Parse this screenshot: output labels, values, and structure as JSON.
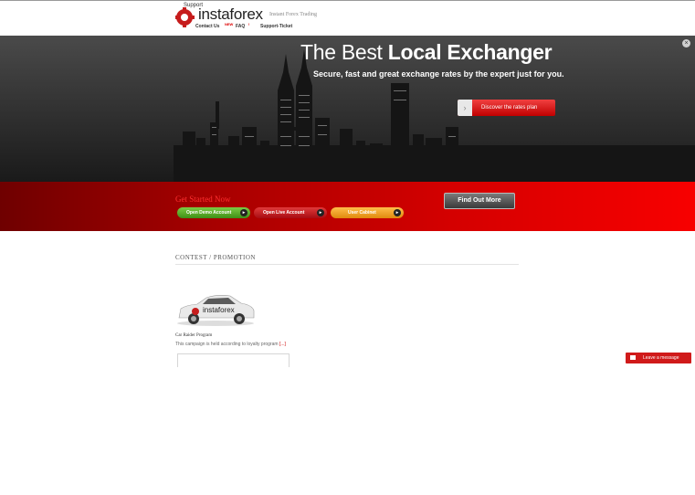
{
  "header": {
    "support_label": "Support",
    "logo_text": "instaforex",
    "tagline": "Instant Forex Trading",
    "nav": [
      {
        "label": "Contact Us",
        "badge": "NEW"
      },
      {
        "label": "FAQ",
        "badge": "!"
      },
      {
        "label": "Support-Ticket",
        "badge": ""
      }
    ]
  },
  "hero": {
    "title_light": "The Best ",
    "title_bold": "Local Exchanger",
    "subtitle": "Secure, fast and great exchange rates by the expert just for you.",
    "rates_button": "Discover the rates plan",
    "arrow_icon": "›",
    "close_icon": "×"
  },
  "get_started": {
    "title": "Get Started Now",
    "buttons": [
      {
        "label": "Open Demo Account",
        "color": "#5aa72a"
      },
      {
        "label": "Open Live Account",
        "color": "#c8161d"
      },
      {
        "label": "User Cabinet",
        "color": "#f09a19"
      }
    ],
    "find_out_more": "Find Out More",
    "go_icon": "▸"
  },
  "contest": {
    "title": "CONTEST / PROMOTION",
    "items": [
      {
        "title": "Car Raider Program",
        "description": "This campaign is held according to loyalty program ",
        "more": "[...]"
      }
    ]
  },
  "chat": {
    "leave_message": "Leave a message"
  },
  "colors": {
    "brand_red": "#d40000",
    "demo_green": "#5aa72a",
    "live_red": "#c8161d",
    "cabinet_orange": "#f09a19"
  }
}
